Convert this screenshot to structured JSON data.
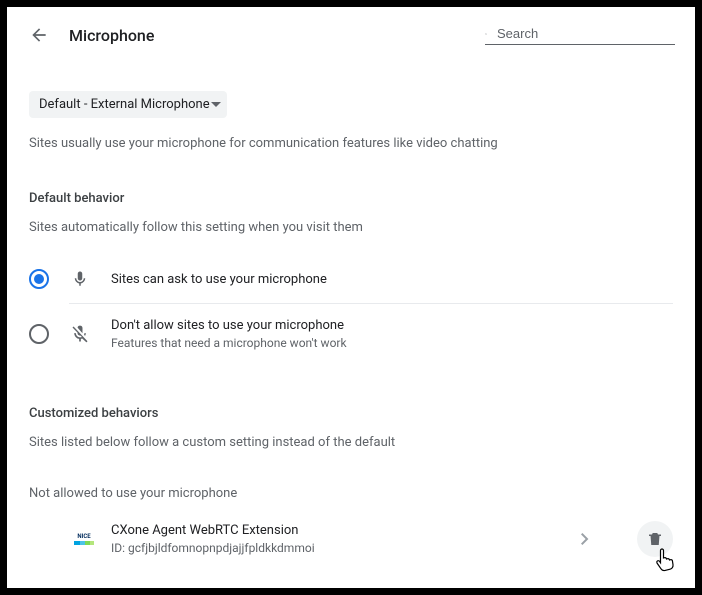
{
  "header": {
    "title": "Microphone",
    "search_placeholder": "Search"
  },
  "device": {
    "selected": "Default - External Microphone"
  },
  "description": "Sites usually use your microphone for communication features like video chatting",
  "default_behavior": {
    "heading": "Default behavior",
    "sub": "Sites automatically follow this setting when you visit them",
    "option_allow": "Sites can ask to use your microphone",
    "option_block": "Don't allow sites to use your microphone",
    "option_block_sub": "Features that need a microphone won't work"
  },
  "customized": {
    "heading": "Customized behaviors",
    "sub": "Sites listed below follow a custom setting instead of the default",
    "not_allowed_heading": "Not allowed to use your microphone",
    "site": {
      "logo_text": "NICE",
      "name": "CXone Agent WebRTC Extension",
      "id": "ID: gcfjbjldfomnopnpdjajjfpldkkdmmoi"
    }
  }
}
